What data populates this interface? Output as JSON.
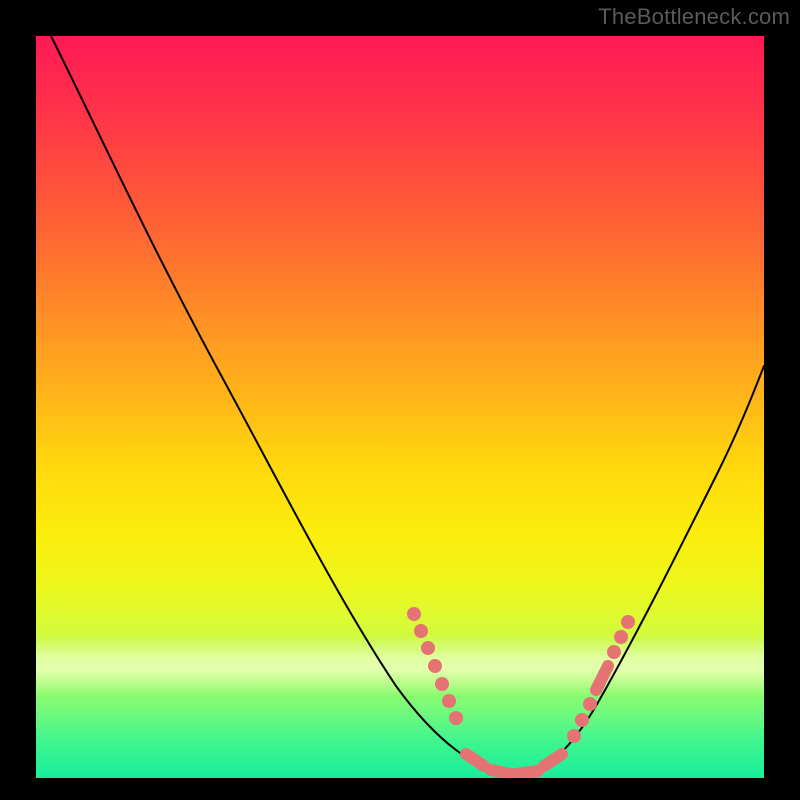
{
  "watermark": "TheBottleneck.com",
  "colors": {
    "background": "#000000",
    "curve": "#000000",
    "markers": "#e57373"
  },
  "chart_data": {
    "type": "line",
    "title": "",
    "xlabel": "",
    "ylabel": "",
    "xlim": [
      0,
      100
    ],
    "ylim": [
      0,
      100
    ],
    "grid": false,
    "legend": false,
    "annotations": [],
    "series": [
      {
        "name": "bottleneck-curve",
        "x": [
          2,
          5,
          10,
          15,
          20,
          25,
          30,
          35,
          40,
          45,
          50,
          55,
          58,
          60,
          63,
          66,
          70,
          75,
          80,
          85,
          90,
          95,
          100
        ],
        "y": [
          100,
          98,
          93,
          87,
          79,
          70,
          60,
          49,
          38,
          27,
          17,
          9,
          5,
          3,
          1,
          0,
          2,
          8,
          17,
          27,
          37,
          47,
          56
        ]
      }
    ],
    "marker_clusters": [
      {
        "name": "left-cluster",
        "x_range": [
          52,
          58
        ],
        "y_range": [
          7,
          22
        ],
        "shape": "dots"
      },
      {
        "name": "bottom-cluster",
        "x_range": [
          59,
          71
        ],
        "y_range": [
          0,
          3
        ],
        "shape": "pills"
      },
      {
        "name": "right-cluster",
        "x_range": [
          73,
          80
        ],
        "y_range": [
          7,
          22
        ],
        "shape": "dots-and-pill"
      }
    ]
  }
}
